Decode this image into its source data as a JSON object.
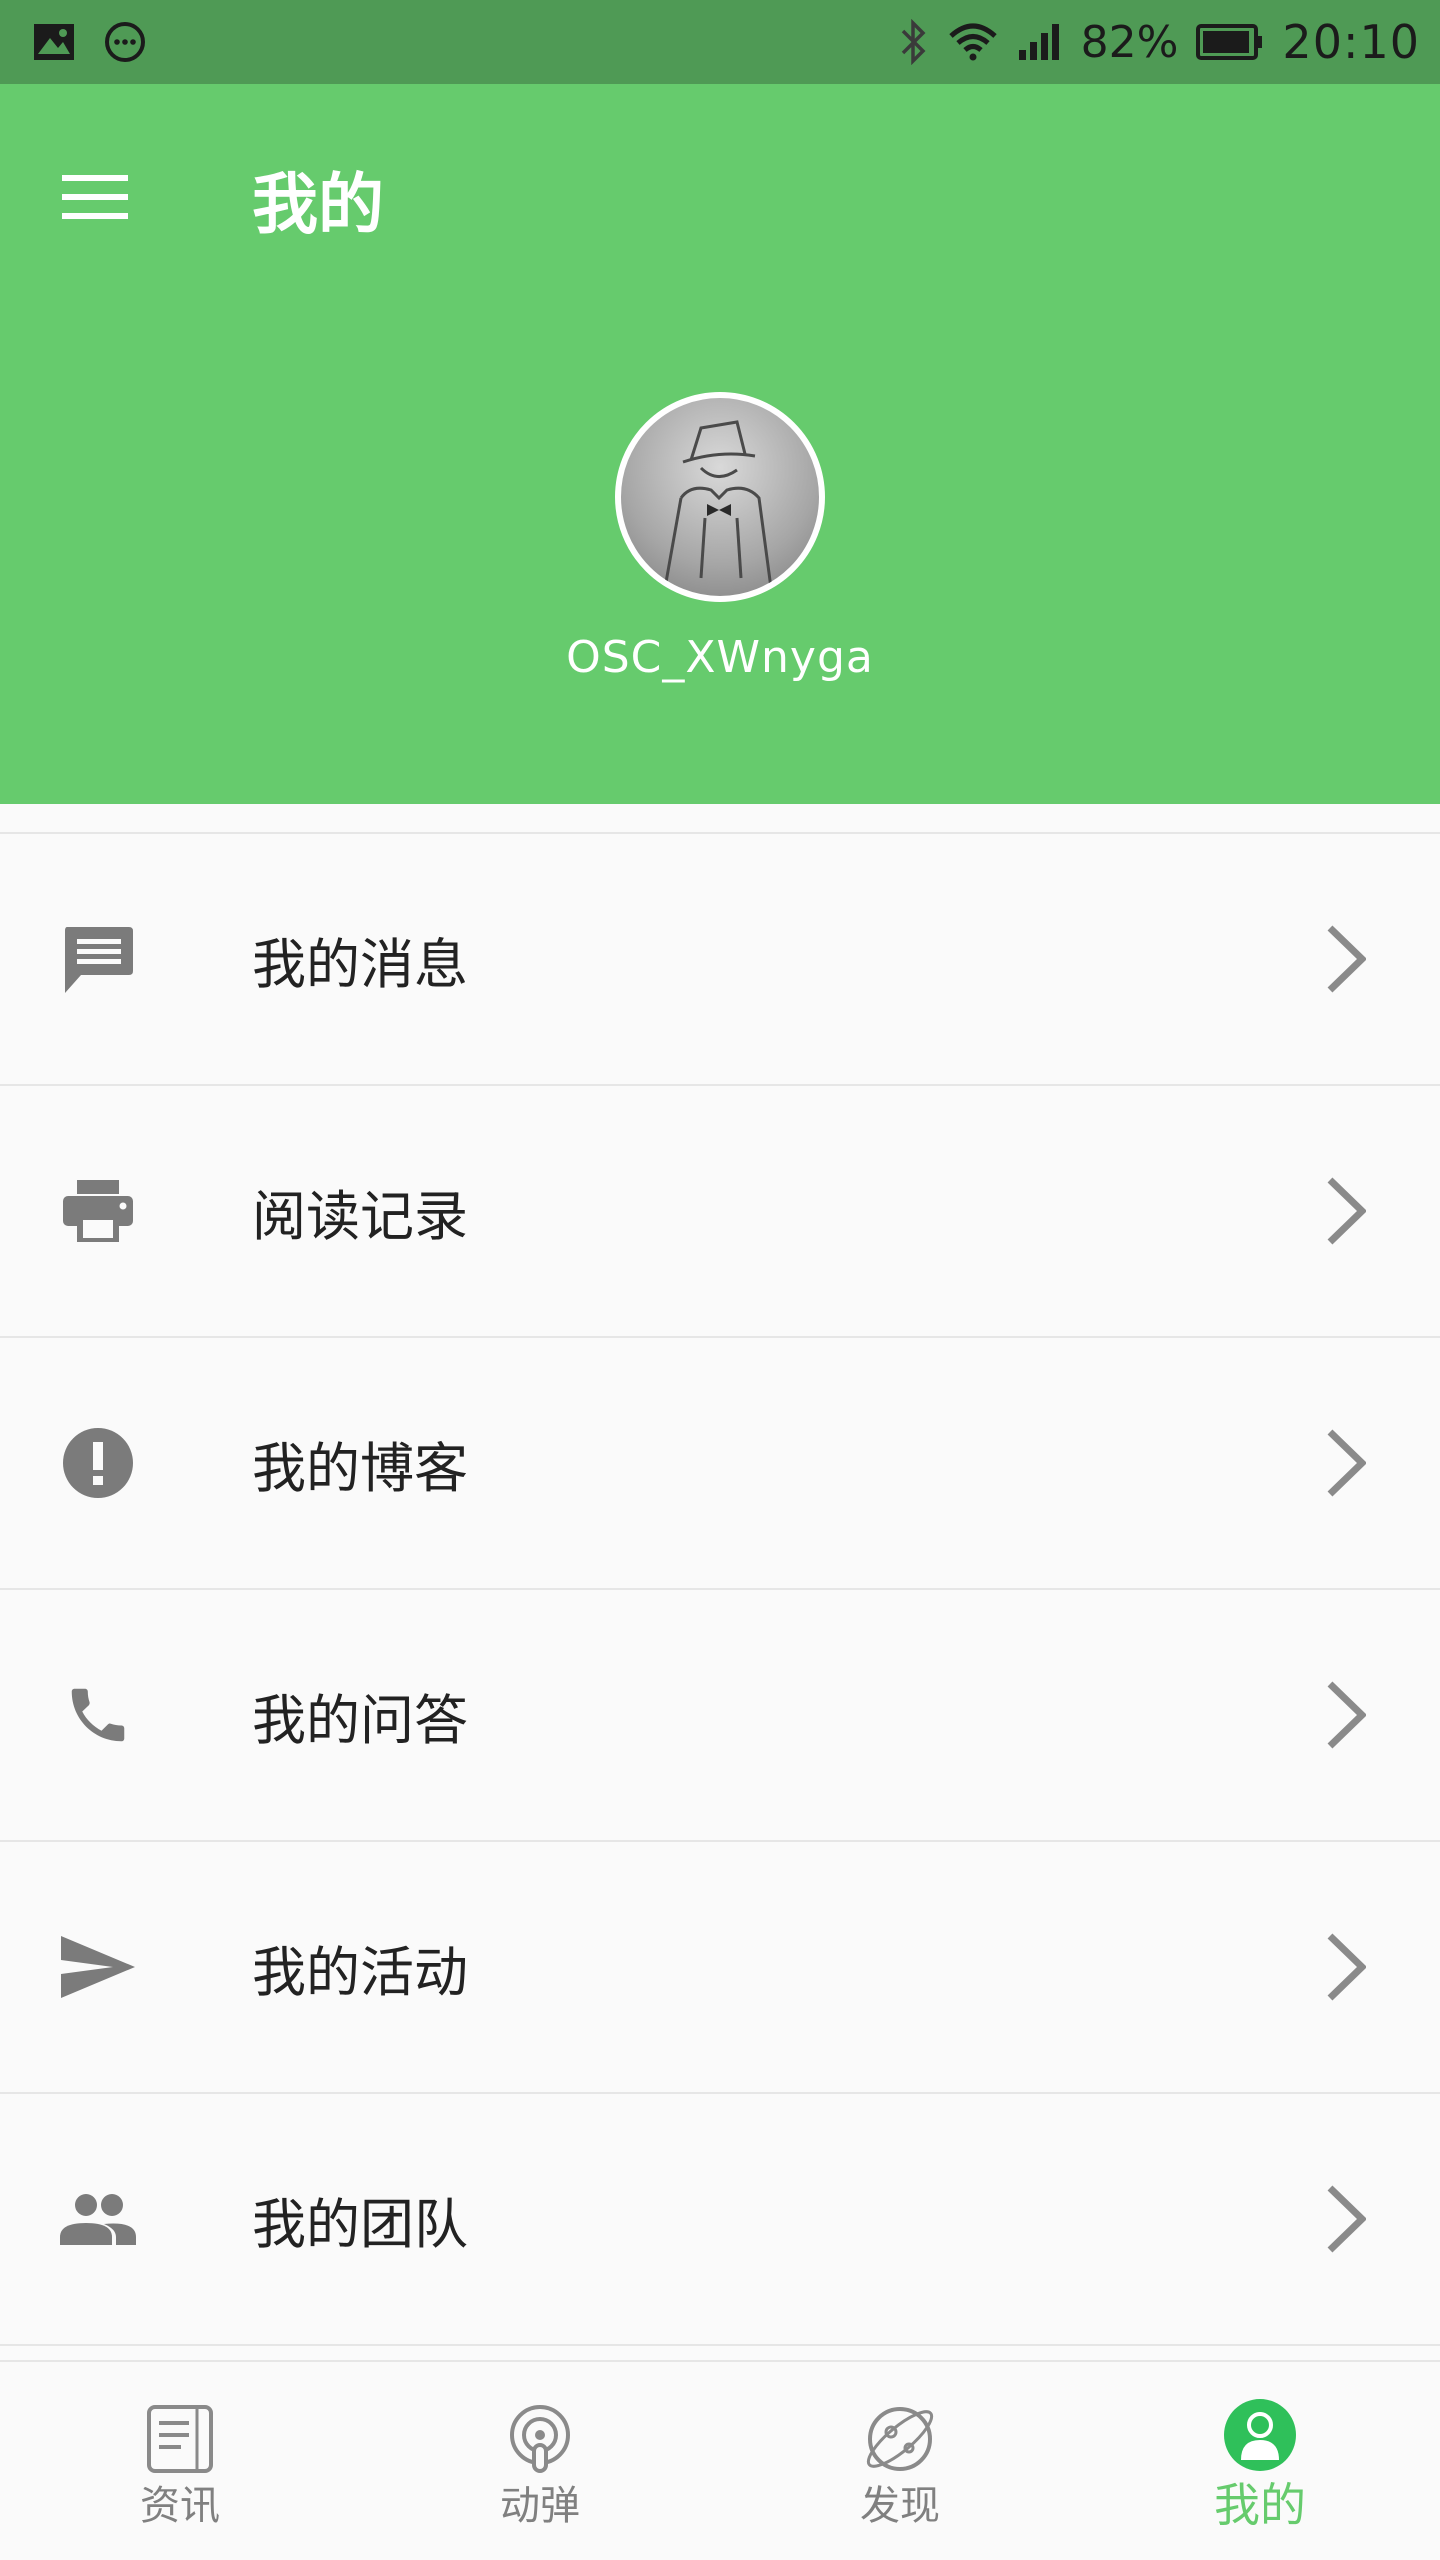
{
  "status_bar": {
    "battery": "82%",
    "time": "20:10",
    "icons": [
      "image-icon",
      "message-dots-icon",
      "bluetooth-icon",
      "wifi-icon",
      "signal-icon",
      "battery-icon"
    ]
  },
  "header": {
    "title": "我的",
    "username": "OSC_XWnyga",
    "menu_icon": "hamburger-icon",
    "color": "#66cb6d"
  },
  "menu": {
    "items": [
      {
        "label": "我的消息",
        "icon": "message-icon"
      },
      {
        "label": "阅读记录",
        "icon": "printer-icon"
      },
      {
        "label": "我的博客",
        "icon": "alert-circle-icon"
      },
      {
        "label": "我的问答",
        "icon": "phone-icon"
      },
      {
        "label": "我的活动",
        "icon": "send-icon"
      },
      {
        "label": "我的团队",
        "icon": "people-icon"
      }
    ]
  },
  "bottom_nav": {
    "items": [
      {
        "label": "资讯",
        "icon": "news-icon"
      },
      {
        "label": "动弹",
        "icon": "tweet-icon"
      },
      {
        "label": "发现",
        "icon": "discover-icon"
      },
      {
        "label": "我的",
        "icon": "profile-icon",
        "active": true
      }
    ]
  }
}
